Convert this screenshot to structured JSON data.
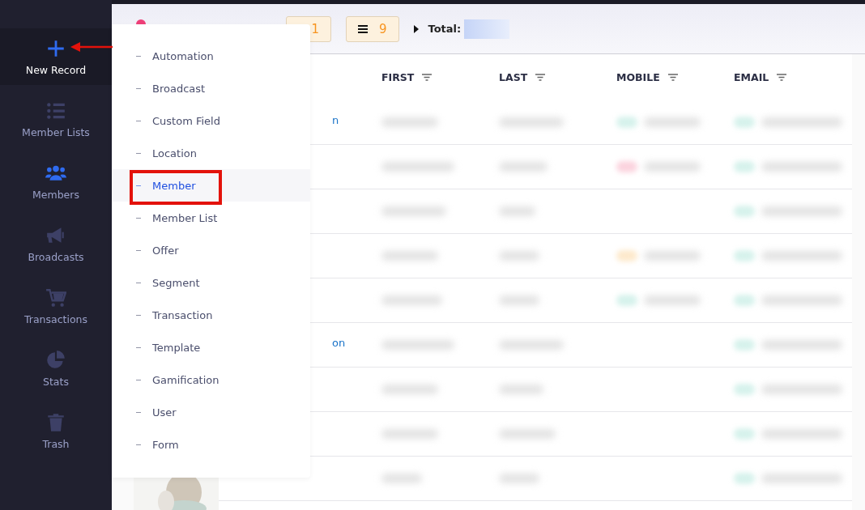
{
  "sidebar": {
    "items": [
      {
        "label": "New Record",
        "selected": true,
        "current": false
      },
      {
        "label": "Member Lists",
        "selected": false,
        "current": false
      },
      {
        "label": "Members",
        "selected": false,
        "current": true
      },
      {
        "label": "Broadcasts",
        "selected": false,
        "current": false
      },
      {
        "label": "Transactions",
        "selected": false,
        "current": false
      },
      {
        "label": "Stats",
        "selected": false,
        "current": false
      },
      {
        "label": "Trash",
        "selected": false,
        "current": false
      }
    ]
  },
  "header": {
    "badges": [
      {
        "kind": "plain",
        "count": "1"
      },
      {
        "kind": "menu",
        "count": "9"
      }
    ],
    "total_label": "Total:"
  },
  "table": {
    "columns": [
      "FIRST",
      "LAST",
      "MOBILE",
      "EMAIL"
    ],
    "rows": [
      {
        "fragment": "n",
        "mobile": {
          "color": "#d6f2ec"
        }
      },
      {
        "mobile": {
          "color": "#fbd3de"
        }
      },
      {},
      {
        "mobile": {
          "color": "#fde9cc"
        }
      },
      {
        "mobile": {
          "color": "#d6f2ec"
        }
      },
      {
        "fragment": "on"
      },
      {},
      {},
      {}
    ]
  },
  "new_record_menu": {
    "items": [
      {
        "label": "Automation",
        "selected": false
      },
      {
        "label": "Broadcast",
        "selected": false
      },
      {
        "label": "Custom Field",
        "selected": false
      },
      {
        "label": "Location",
        "selected": false
      },
      {
        "label": "Member",
        "selected": true
      },
      {
        "label": "Member List",
        "selected": false
      },
      {
        "label": "Offer",
        "selected": false
      },
      {
        "label": "Segment",
        "selected": false
      },
      {
        "label": "Transaction",
        "selected": false
      },
      {
        "label": "Template",
        "selected": false
      },
      {
        "label": "Gamification",
        "selected": false
      },
      {
        "label": "User",
        "selected": false
      },
      {
        "label": "Form",
        "selected": false
      }
    ]
  }
}
